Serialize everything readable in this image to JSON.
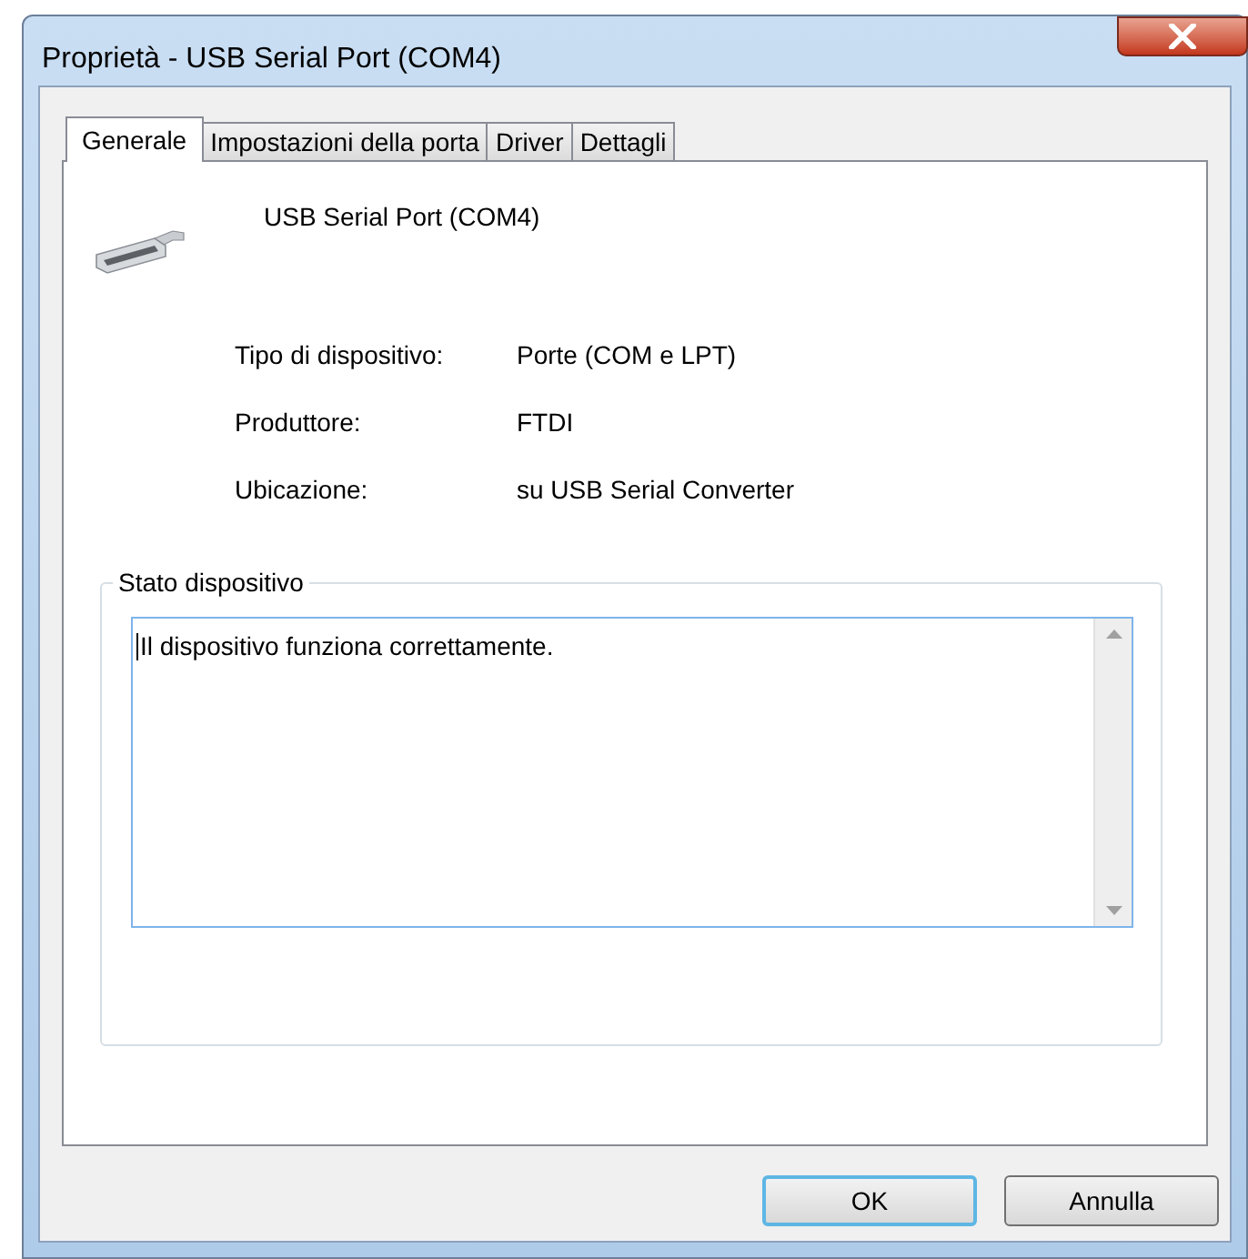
{
  "window": {
    "title": "Proprietà - USB Serial Port (COM4)"
  },
  "tabs": [
    {
      "label": "Generale",
      "selected": true
    },
    {
      "label": "Impostazioni della porta",
      "selected": false
    },
    {
      "label": "Driver",
      "selected": false
    },
    {
      "label": "Dettagli",
      "selected": false
    }
  ],
  "device": {
    "name": "USB Serial Port (COM4)"
  },
  "properties": [
    {
      "label": "Tipo di dispositivo:",
      "value": "Porte (COM e LPT)"
    },
    {
      "label": "Produttore:",
      "value": "FTDI"
    },
    {
      "label": "Ubicazione:",
      "value": "su USB Serial Converter"
    }
  ],
  "status_group": {
    "title": "Stato dispositivo",
    "text": "Il dispositivo funziona correttamente."
  },
  "buttons": [
    {
      "label": "OK",
      "default": true
    },
    {
      "label": "Annulla",
      "default": false
    }
  ]
}
